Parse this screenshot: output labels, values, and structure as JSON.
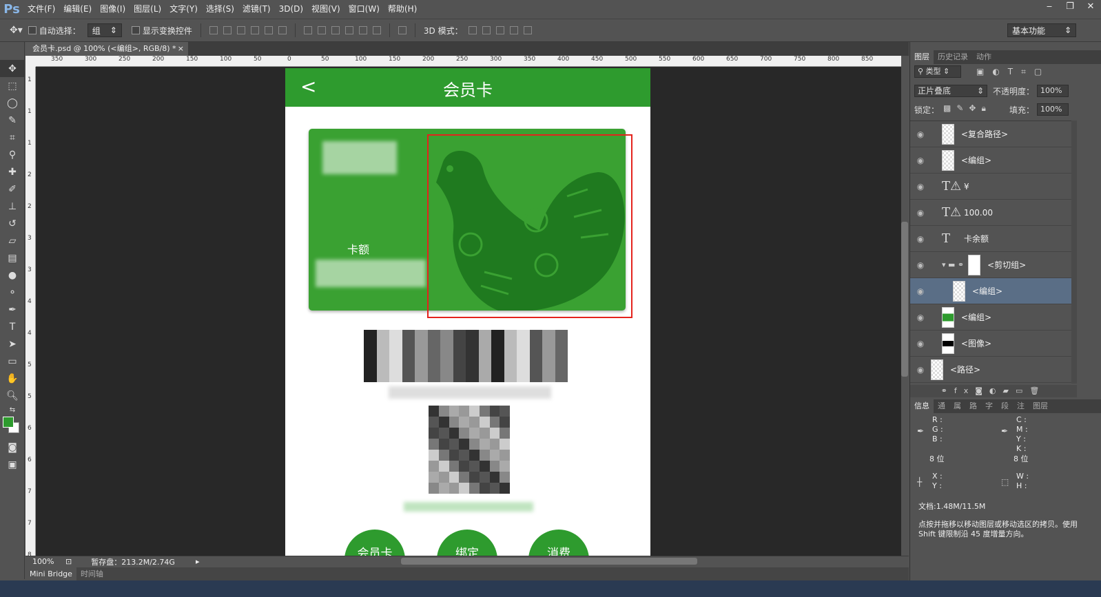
{
  "app": {
    "logo": "Ps"
  },
  "menu": [
    "文件(F)",
    "编辑(E)",
    "图像(I)",
    "图层(L)",
    "文字(Y)",
    "选择(S)",
    "滤镜(T)",
    "3D(D)",
    "视图(V)",
    "窗口(W)",
    "帮助(H)"
  ],
  "window_controls": [
    "‒",
    "❐",
    "✕"
  ],
  "options": {
    "auto_select_label": "自动选择：",
    "auto_select_value": "组",
    "show_transform_label": "显示变换控件",
    "mode_3d_label": "3D 模式：",
    "workspace": "基本功能"
  },
  "document": {
    "tab_title": "会员卡.psd @ 100% (<编组>, RGB/8) *",
    "tab_close": "×"
  },
  "ruler": {
    "h_labels": [
      "350",
      "300",
      "250",
      "200",
      "150",
      "100",
      "50",
      "0",
      "50",
      "100",
      "150",
      "200",
      "250",
      "300",
      "350",
      "400",
      "450",
      "500",
      "550",
      "600",
      "650",
      "700",
      "750",
      "800",
      "850"
    ],
    "v_labels": [
      "1",
      "1",
      "1",
      "2",
      "2",
      "3",
      "3",
      "4",
      "4",
      "5",
      "5",
      "6",
      "6",
      "7",
      "7",
      "8"
    ]
  },
  "app_screen": {
    "back": "<",
    "title": "会员卡",
    "card_label": "卡额",
    "buttons": [
      "会员卡",
      "绑定",
      "消费"
    ]
  },
  "status": {
    "zoom": "100%",
    "scratch": "暂存盘：213.2M/2.74G"
  },
  "bottom_tabs": [
    "Mini Bridge",
    "时间轴"
  ],
  "layers_panel": {
    "tabs": [
      "图层",
      "历史记录",
      "动作"
    ],
    "filter_label": "类型",
    "blend_mode": "正片叠底",
    "opacity_label": "不透明度：",
    "opacity_value": "100%",
    "lock_label": "锁定：",
    "fill_label": "填充：",
    "fill_value": "100%",
    "layers": [
      {
        "name": "<复合路径>",
        "kind": "thumb",
        "indent": 1
      },
      {
        "name": "<编组>",
        "kind": "thumb",
        "indent": 1
      },
      {
        "name": "¥",
        "kind": "text-warn",
        "indent": 1
      },
      {
        "name": "100.00",
        "kind": "text-warn",
        "indent": 1
      },
      {
        "name": "卡余额",
        "kind": "text",
        "indent": 1
      },
      {
        "name": "<剪切组>",
        "kind": "group",
        "indent": 1
      },
      {
        "name": "<编组>",
        "kind": "thumb",
        "indent": 2,
        "selected": true
      },
      {
        "name": "<编组>",
        "kind": "thumb-green",
        "indent": 1
      },
      {
        "name": "<图像>",
        "kind": "thumb-black",
        "indent": 1
      },
      {
        "name": "<路径>",
        "kind": "thumb",
        "indent": 0
      }
    ]
  },
  "info_panel": {
    "tabs": [
      "信息",
      "通",
      "属",
      "路",
      "字",
      "段",
      "注",
      "图层"
    ],
    "left": [
      "R :",
      "G :",
      "B :",
      "8 位"
    ],
    "right": [
      "C :",
      "M :",
      "Y :",
      "K :",
      "8 位"
    ],
    "xy": [
      "X :",
      "Y :"
    ],
    "wh": [
      "W :",
      "H :"
    ],
    "doc": "文档:1.48M/11.5M",
    "hint": "点按并拖移以移动图层或移动选区的拷贝。使用 Shift 键限制沿 45 度增量方向。"
  },
  "colors": {
    "green": "#2e9b2e",
    "selection": "#e4221c",
    "fg": "#2e9b2e",
    "bg": "#ffffff"
  }
}
